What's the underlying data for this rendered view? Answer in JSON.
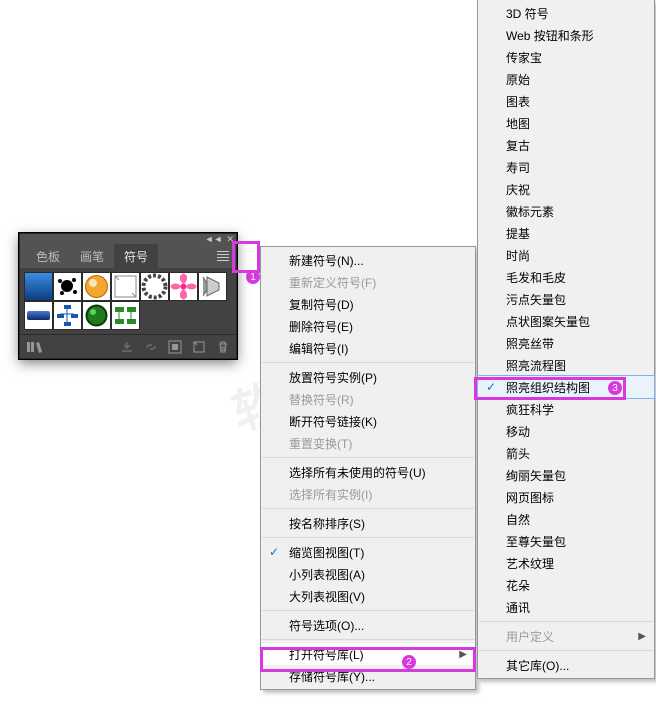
{
  "panel": {
    "tabs": [
      "色板",
      "画笔",
      "符号"
    ],
    "activeTab": 2
  },
  "menu1": {
    "groups": [
      [
        {
          "label": "新建符号(N)...",
          "disabled": false
        },
        {
          "label": "重新定义符号(F)",
          "disabled": true
        },
        {
          "label": "复制符号(D)",
          "disabled": false
        },
        {
          "label": "删除符号(E)",
          "disabled": false
        },
        {
          "label": "编辑符号(I)",
          "disabled": false
        }
      ],
      [
        {
          "label": "放置符号实例(P)",
          "disabled": false
        },
        {
          "label": "替换符号(R)",
          "disabled": true
        },
        {
          "label": "断开符号链接(K)",
          "disabled": false
        },
        {
          "label": "重置变换(T)",
          "disabled": true
        }
      ],
      [
        {
          "label": "选择所有未使用的符号(U)",
          "disabled": false
        },
        {
          "label": "选择所有实例(I)",
          "disabled": true
        }
      ],
      [
        {
          "label": "按名称排序(S)",
          "disabled": false
        }
      ],
      [
        {
          "label": "缩览图视图(T)",
          "disabled": false,
          "checked": true
        },
        {
          "label": "小列表视图(A)",
          "disabled": false
        },
        {
          "label": "大列表视图(V)",
          "disabled": false
        }
      ],
      [
        {
          "label": "符号选项(O)...",
          "disabled": false
        }
      ],
      [
        {
          "label": "打开符号库(L)",
          "disabled": false,
          "submenu": true,
          "hl": true
        },
        {
          "label": "存储符号库(Y)...",
          "disabled": false
        }
      ]
    ]
  },
  "menu2": {
    "items": [
      {
        "label": "3D 符号"
      },
      {
        "label": "Web 按钮和条形"
      },
      {
        "label": "传家宝"
      },
      {
        "label": "原始"
      },
      {
        "label": "图表"
      },
      {
        "label": "地图"
      },
      {
        "label": "复古"
      },
      {
        "label": "寿司"
      },
      {
        "label": "庆祝"
      },
      {
        "label": "徽标元素"
      },
      {
        "label": "提基"
      },
      {
        "label": "时尚"
      },
      {
        "label": "毛发和毛皮"
      },
      {
        "label": "污点矢量包"
      },
      {
        "label": "点状图案矢量包"
      },
      {
        "label": "照亮丝带"
      },
      {
        "label": "照亮流程图"
      },
      {
        "label": "照亮组织结构图",
        "checked": true,
        "sel": true
      },
      {
        "label": "疯狂科学"
      },
      {
        "label": "移动"
      },
      {
        "label": "箭头"
      },
      {
        "label": "绚丽矢量包"
      },
      {
        "label": "网页图标"
      },
      {
        "label": "自然"
      },
      {
        "label": "至尊矢量包"
      },
      {
        "label": "艺术纹理"
      },
      {
        "label": "花朵"
      },
      {
        "label": "通讯"
      },
      {
        "sep": true
      },
      {
        "label": "用户定义",
        "disabled": true,
        "submenu": true
      },
      {
        "sep": true
      },
      {
        "label": "其它库(O)..."
      }
    ]
  },
  "badges": {
    "b1": "1",
    "b2": "2",
    "b3": "3"
  },
  "watermark": "软件"
}
